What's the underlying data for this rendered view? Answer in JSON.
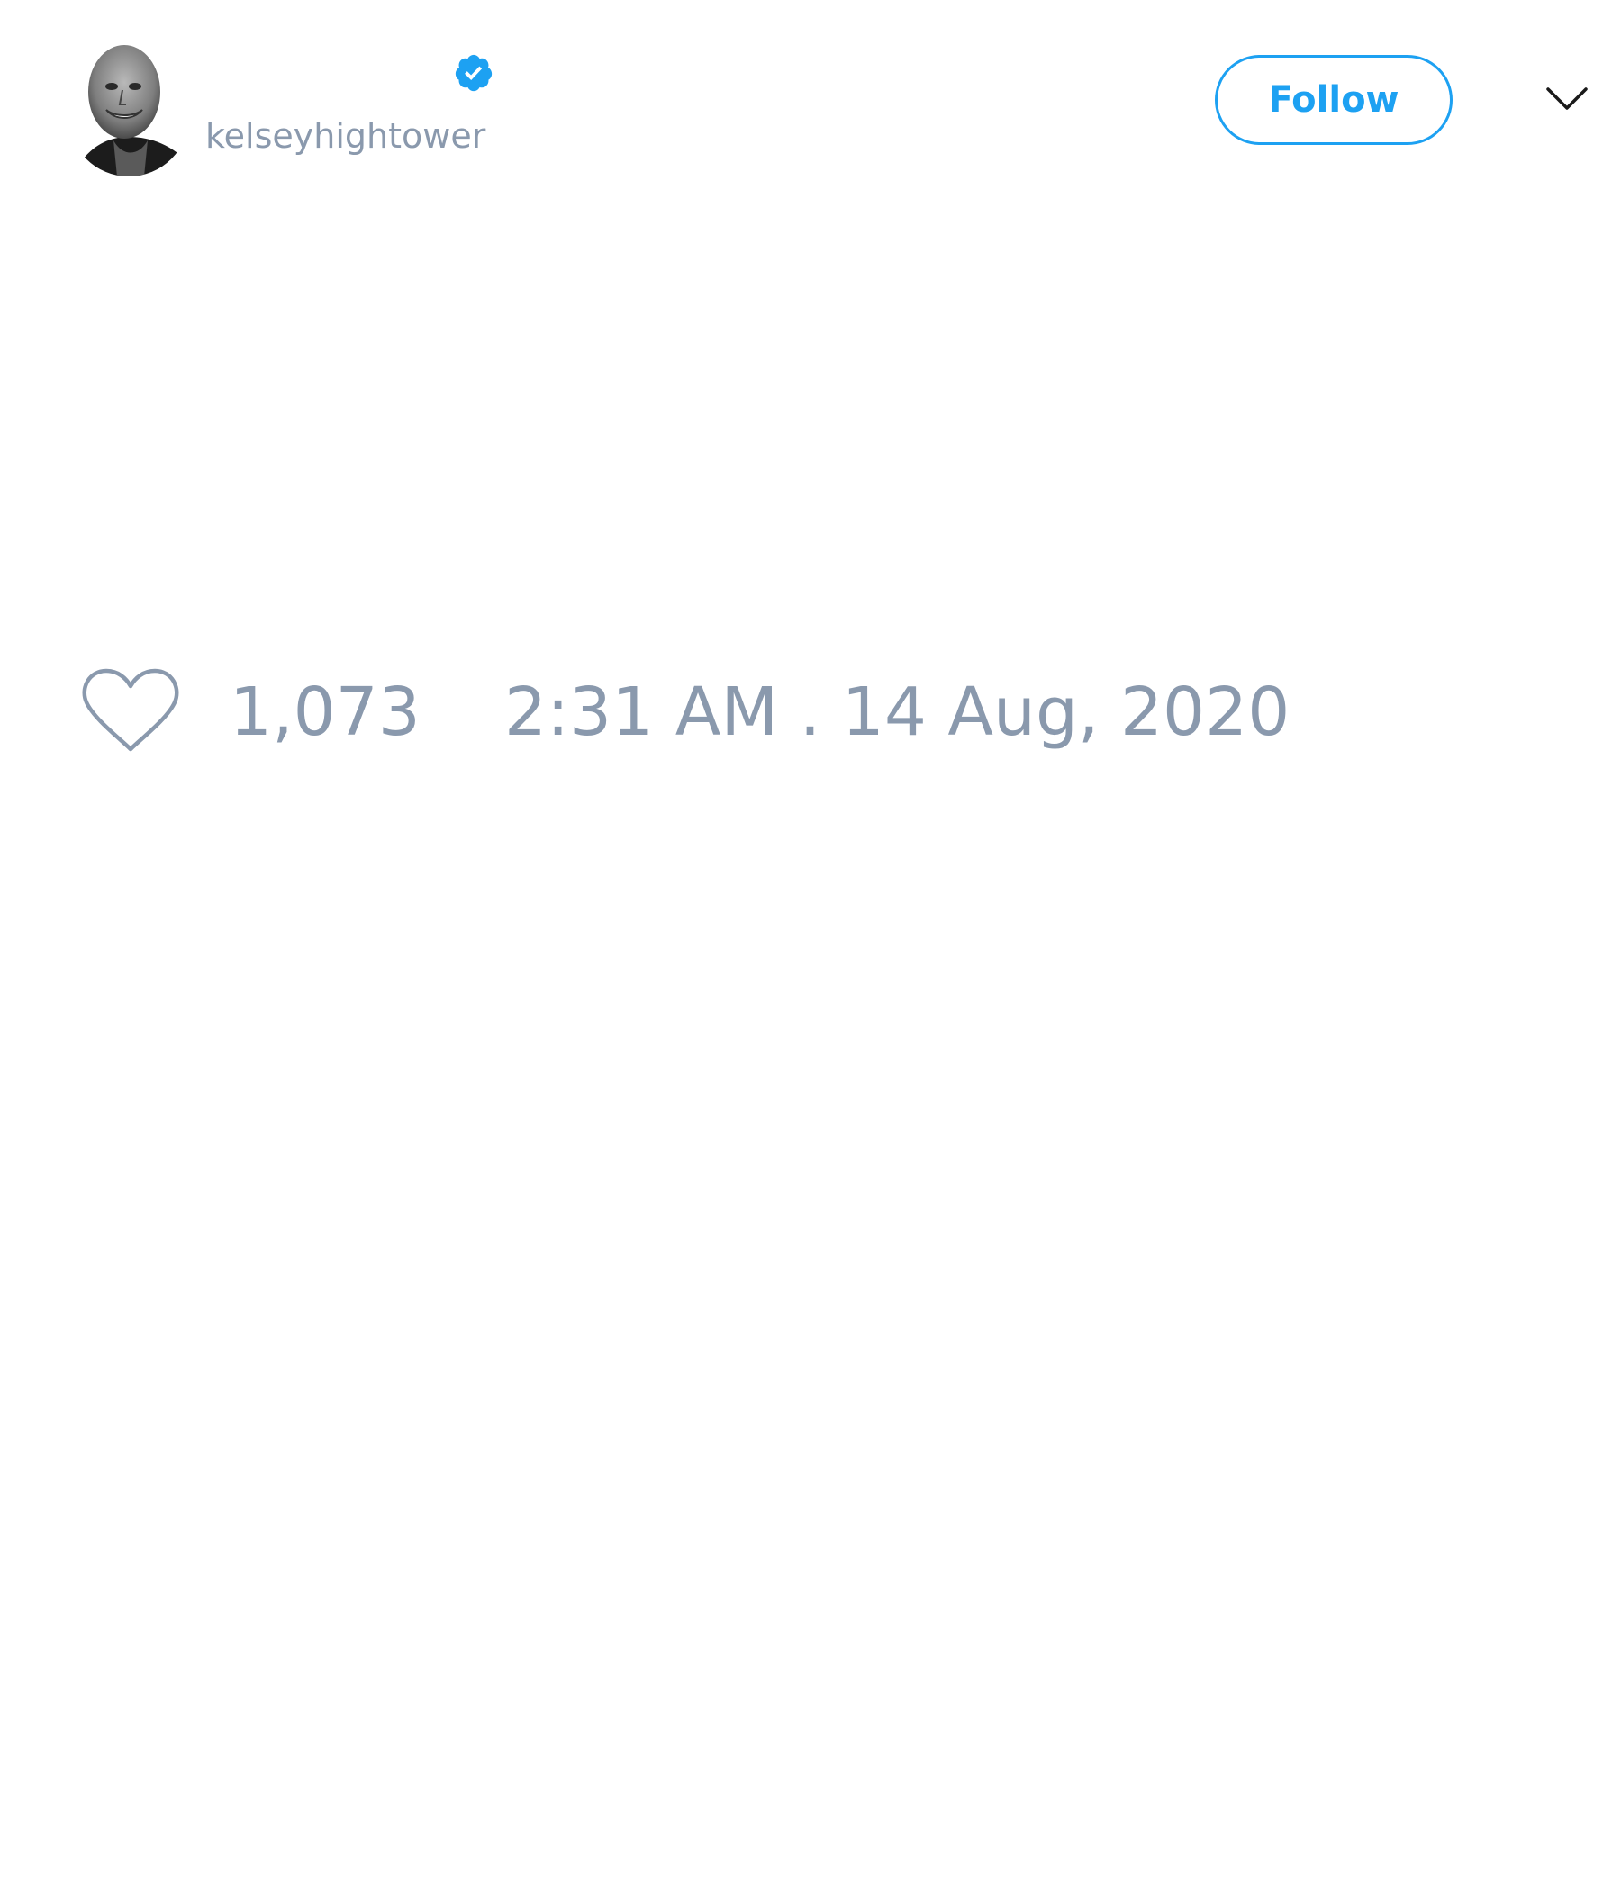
{
  "author": {
    "handle": "kelseyhightower",
    "verified": true,
    "avatar_icon": "profile-photo"
  },
  "header": {
    "follow_label": "Follow",
    "menu_icon": "chevron-down-icon"
  },
  "tweet": {
    "like_icon": "heart-icon",
    "like_count": "1,073",
    "timestamp": "2:31 AM . 14 Aug, 2020"
  },
  "colors": {
    "accent": "#1da1f2",
    "muted_text": "#8a99ad",
    "background": "#ffffff"
  }
}
